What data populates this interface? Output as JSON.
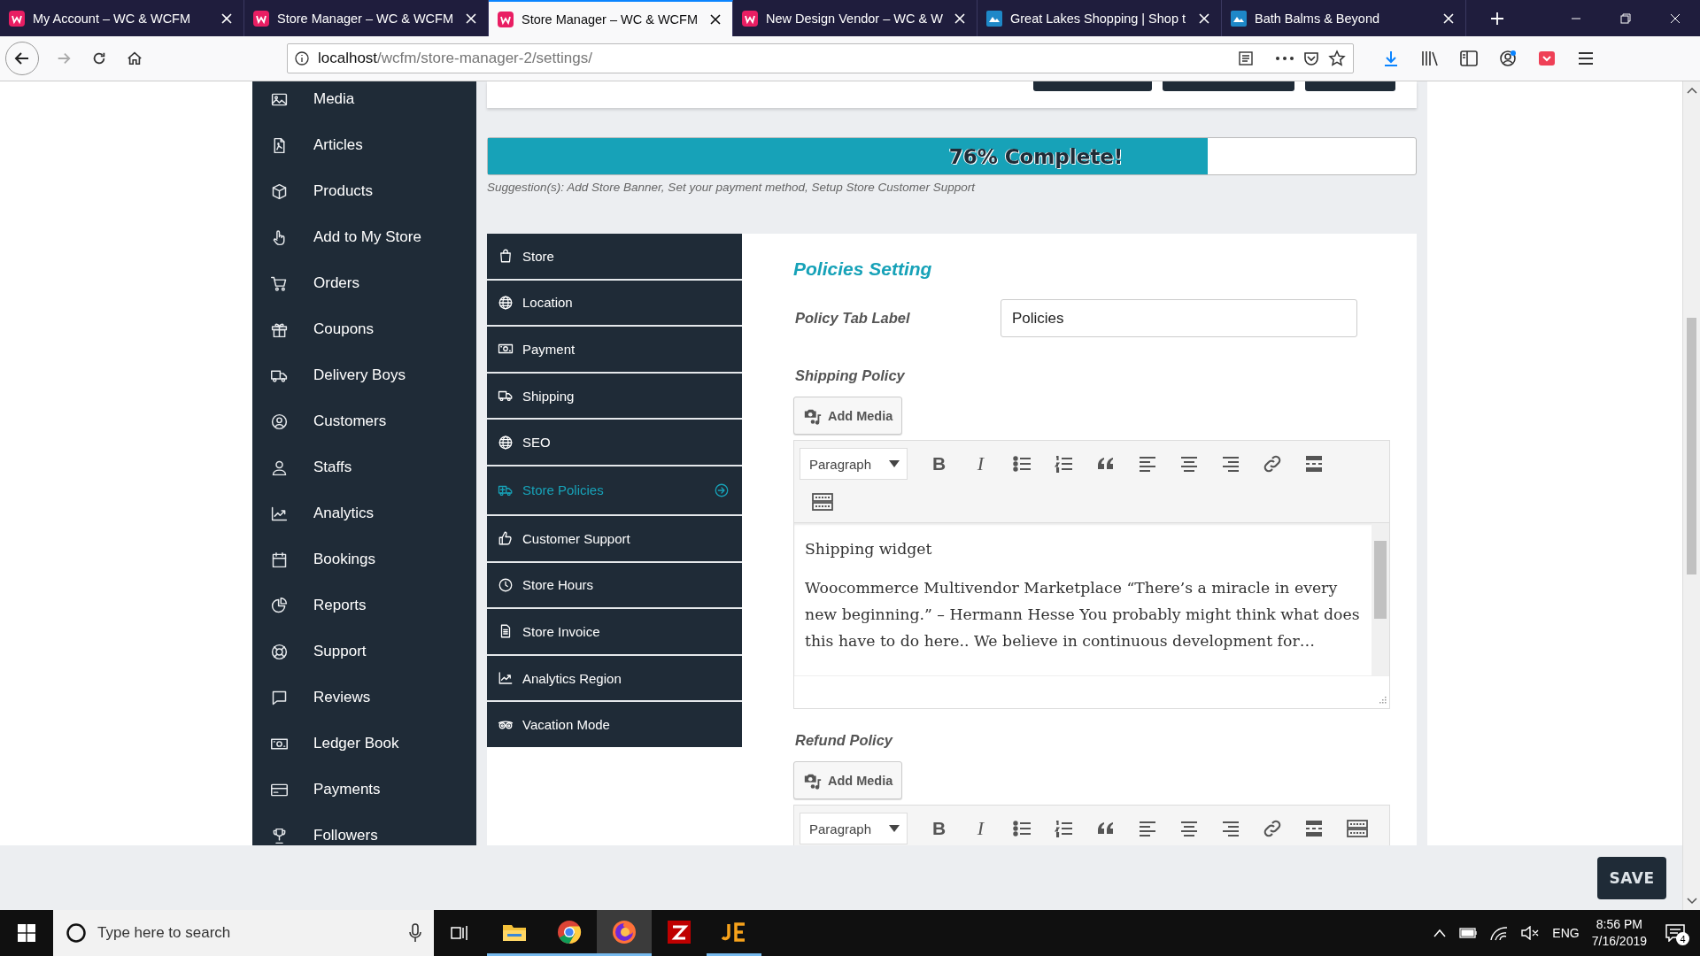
{
  "browser": {
    "tabs": [
      {
        "title": "My Account – WC & WCFM",
        "kind": "pink",
        "selected": false
      },
      {
        "title": "Store Manager – WC & WCFM",
        "kind": "pink",
        "selected": false
      },
      {
        "title": "Store Manager – WC & WCFM",
        "kind": "pink",
        "selected": true
      },
      {
        "title": "New Design Vendor – WC & W",
        "kind": "pink",
        "selected": false
      },
      {
        "title": "Great Lakes Shopping | Shop t",
        "kind": "blue",
        "selected": false
      },
      {
        "title": "Bath Balms & Beyond",
        "kind": "blue",
        "selected": false
      }
    ],
    "url": {
      "host": "localhost",
      "path": "/wcfm/store-manager-2/settings/"
    }
  },
  "sidebar": {
    "items": [
      {
        "label": "Media"
      },
      {
        "label": "Articles"
      },
      {
        "label": "Products"
      },
      {
        "label": "Add to My Store"
      },
      {
        "label": "Orders"
      },
      {
        "label": "Coupons"
      },
      {
        "label": "Delivery Boys"
      },
      {
        "label": "Customers"
      },
      {
        "label": "Staffs"
      },
      {
        "label": "Analytics"
      },
      {
        "label": "Bookings"
      },
      {
        "label": "Reports"
      },
      {
        "label": "Support"
      },
      {
        "label": "Reviews"
      },
      {
        "label": "Ledger Book"
      },
      {
        "label": "Payments"
      },
      {
        "label": "Followers"
      }
    ]
  },
  "progress": {
    "label": "76% Complete!",
    "level": 0.776,
    "suggestion": "Suggestion(s): Add Store Banner, Set your payment method, Setup Store Customer Support"
  },
  "settings_menu": [
    {
      "label": "Store",
      "selected": false
    },
    {
      "label": "Location",
      "selected": false
    },
    {
      "label": "Payment",
      "selected": false
    },
    {
      "label": "Shipping",
      "selected": false
    },
    {
      "label": "SEO",
      "selected": false
    },
    {
      "label": "Store Policies",
      "selected": true
    },
    {
      "label": "Customer Support",
      "selected": false
    },
    {
      "label": "Store Hours",
      "selected": false
    },
    {
      "label": "Store Invoice",
      "selected": false
    },
    {
      "label": "Analytics Region",
      "selected": false
    },
    {
      "label": "Vacation Mode",
      "selected": false
    }
  ],
  "policies": {
    "title": "Policies Setting",
    "tab_label": {
      "label": "Policy Tab Label",
      "value": "Policies"
    },
    "editors": [
      {
        "label": "Shipping Policy",
        "add_media": "Add Media",
        "format": "Paragraph",
        "bold": "B",
        "italic": "I",
        "content": [
          "Shipping widget",
          "Woocommerce Multivendor Marketplace “There’s a miracle in every new beginning.” – Hermann Hesse You probably might think what does this have to do here.. We believe in continuous development for…"
        ]
      },
      {
        "label": "Refund Policy",
        "add_media": "Add Media",
        "format": "Paragraph",
        "bold": "B",
        "italic": "I"
      }
    ]
  },
  "save_button": "SAVE",
  "taskbar": {
    "search_placeholder": "Type here to search",
    "apps": [
      {
        "selected": false,
        "running": true
      },
      {
        "selected": false,
        "running": true
      },
      {
        "selected": true,
        "running": true
      },
      {
        "selected": false,
        "running": false
      },
      {
        "selected": false,
        "running": true
      }
    ],
    "language": "ENG",
    "time": "8:56 PM",
    "date": "7/16/2019",
    "notifications": "4"
  }
}
